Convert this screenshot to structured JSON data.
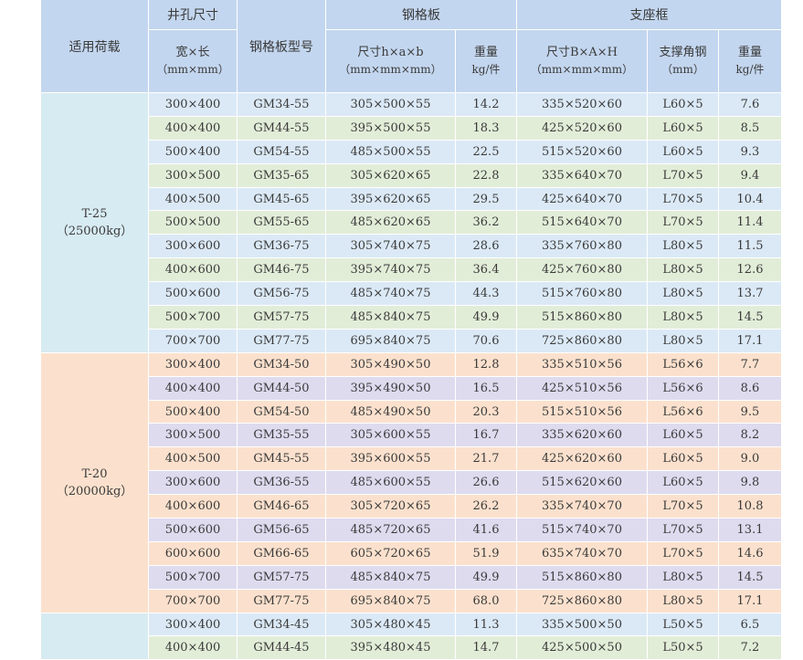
{
  "header": {
    "load": "适用荷载",
    "hole": "井孔尺寸",
    "hole_sub": "宽×长",
    "hole_unit": "（mm×mm）",
    "model": "钢格板型号",
    "grate": "钢格板",
    "grate_size": "尺寸h×a×b",
    "grate_size_unit": "（mm×mm×mm）",
    "grate_weight": "重量",
    "grate_weight_unit": "kg/件",
    "frame": "支座框",
    "frame_size": "尺寸B×A×H",
    "frame_size_unit": "（mm×mm×mm）",
    "angle": "支撑角钢",
    "angle_unit": "（mm）",
    "frame_weight": "重量",
    "frame_weight_unit": "kg/件"
  },
  "groups": [
    {
      "load": "T-25",
      "load_kg": "（25000kg）",
      "rows": [
        [
          "300×400",
          "GM34-55",
          "305×500×55",
          "14.2",
          "335×520×60",
          "L60×5",
          "7.6"
        ],
        [
          "400×400",
          "GM44-55",
          "395×500×55",
          "18.3",
          "425×520×60",
          "L60×5",
          "8.5"
        ],
        [
          "500×400",
          "GM54-55",
          "485×500×55",
          "22.5",
          "515×520×60",
          "L60×5",
          "9.3"
        ],
        [
          "300×500",
          "GM35-65",
          "305×620×65",
          "22.8",
          "335×640×70",
          "L70×5",
          "9.4"
        ],
        [
          "400×500",
          "GM45-65",
          "395×620×65",
          "29.5",
          "425×640×70",
          "L70×5",
          "10.4"
        ],
        [
          "500×500",
          "GM55-65",
          "485×620×65",
          "36.2",
          "515×640×70",
          "L70×5",
          "11.4"
        ],
        [
          "300×600",
          "GM36-75",
          "305×740×75",
          "28.6",
          "335×760×80",
          "L80×5",
          "11.5"
        ],
        [
          "400×600",
          "GM46-75",
          "395×740×75",
          "36.4",
          "425×760×80",
          "L80×5",
          "12.6"
        ],
        [
          "500×600",
          "GM56-75",
          "485×740×75",
          "44.3",
          "515×760×80",
          "L80×5",
          "13.7"
        ],
        [
          "500×700",
          "GM57-75",
          "485×840×75",
          "49.9",
          "515×860×80",
          "L80×5",
          "14.5"
        ],
        [
          "700×700",
          "GM77-75",
          "695×840×75",
          "70.6",
          "725×860×80",
          "L80×5",
          "17.1"
        ]
      ]
    },
    {
      "load": "T-20",
      "load_kg": "（20000kg）",
      "rows": [
        [
          "300×400",
          "GM34-50",
          "305×490×50",
          "12.8",
          "335×510×56",
          "L56×6",
          "7.7"
        ],
        [
          "400×400",
          "GM44-50",
          "395×490×50",
          "16.5",
          "425×510×56",
          "L56×6",
          "8.6"
        ],
        [
          "500×400",
          "GM54-50",
          "485×490×50",
          "20.3",
          "515×510×56",
          "L56×6",
          "9.5"
        ],
        [
          "300×500",
          "GM35-55",
          "305×600×55",
          "16.7",
          "335×620×60",
          "L60×5",
          "8.2"
        ],
        [
          "400×500",
          "GM45-55",
          "395×600×55",
          "21.7",
          "425×620×60",
          "L60×5",
          "9.0"
        ],
        [
          "300×600",
          "GM36-55",
          "485×600×55",
          "26.6",
          "515×620×60",
          "L60×5",
          "9.8"
        ],
        [
          "400×600",
          "GM46-65",
          "305×720×65",
          "26.2",
          "335×740×70",
          "L70×5",
          "10.8"
        ],
        [
          "500×600",
          "GM56-65",
          "485×720×65",
          "41.6",
          "515×740×70",
          "L70×5",
          "13.1"
        ],
        [
          "600×600",
          "GM66-65",
          "605×720×65",
          "51.9",
          "635×740×70",
          "L70×5",
          "14.6"
        ],
        [
          "500×700",
          "GM57-75",
          "485×840×75",
          "49.9",
          "515×860×80",
          "L80×5",
          "14.5"
        ],
        [
          "700×700",
          "GM77-75",
          "695×840×75",
          "68.0",
          "725×860×80",
          "L80×5",
          "17.1"
        ]
      ]
    },
    {
      "load": "",
      "load_kg": "",
      "rows": [
        [
          "300×400",
          "GM34-45",
          "305×480×45",
          "11.3",
          "335×500×50",
          "L50×5",
          "6.5"
        ],
        [
          "400×400",
          "GM44-45",
          "395×480×45",
          "14.7",
          "425×500×50",
          "L50×5",
          "7.2"
        ]
      ]
    }
  ],
  "colors": {
    "header": "#c3d6ef",
    "blue_row": "#dbe9f6",
    "green_row": "#e2edd8",
    "peach_row": "#fbe1cd",
    "lavender_row": "#dedbef"
  }
}
